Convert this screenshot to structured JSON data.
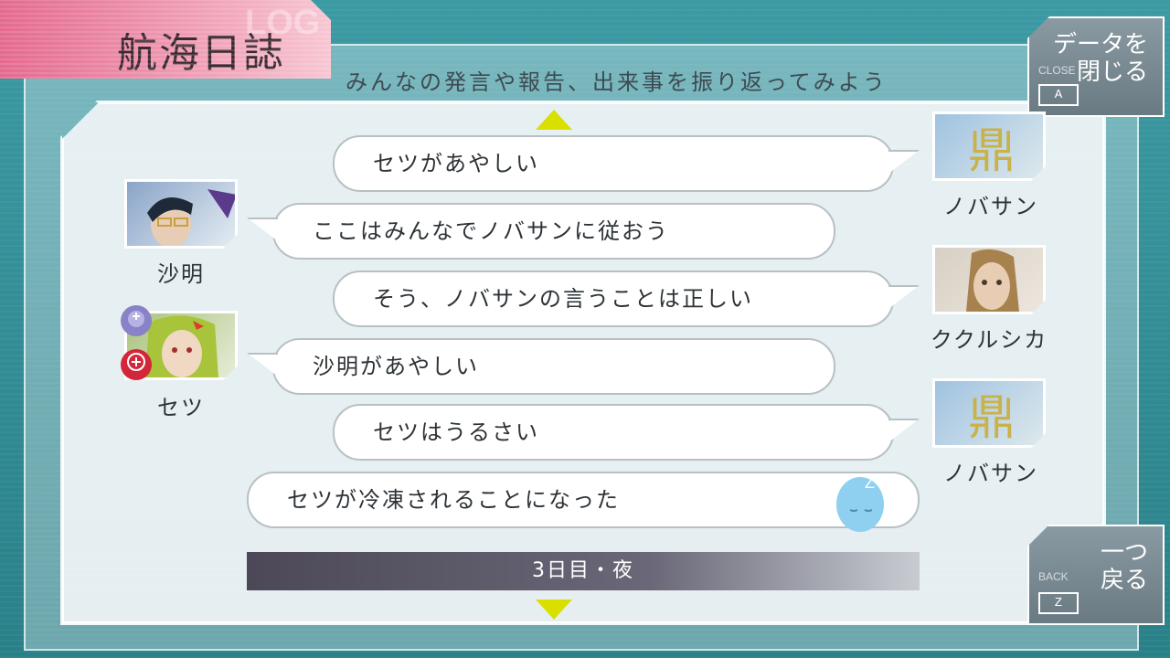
{
  "title": "航海日誌",
  "title_ghost": "LOG",
  "subtitle": "みんなの発言や報告、出来事を振り返ってみよう",
  "close_button": {
    "small": "CLOSE",
    "label_line1": "データを",
    "label_line2": "閉じる",
    "key": "A"
  },
  "back_button": {
    "small": "BACK",
    "label_line1": "一つ",
    "label_line2": "戻る",
    "key": "Z"
  },
  "log": [
    {
      "speaker": "ノバサン",
      "text": "セツがあやしい",
      "side": "right"
    },
    {
      "speaker": "沙明",
      "text": "ここはみんなでノバサンに従おう",
      "side": "left"
    },
    {
      "speaker": "ククルシカ",
      "text": "そう、ノバサンの言うことは正しい",
      "side": "right"
    },
    {
      "speaker": "セツ",
      "text": "沙明があやしい",
      "side": "left"
    },
    {
      "speaker": "ノバサン",
      "text": "セツはうるさい",
      "side": "right"
    },
    {
      "speaker": "",
      "text": "セツが冷凍されることになった",
      "side": "center"
    }
  ],
  "day_label": "3日目・夜",
  "colors": {
    "accent_pink": "#e46a8e",
    "arrow_yellow": "#d9e000",
    "bg_teal": "#2f8f98"
  }
}
